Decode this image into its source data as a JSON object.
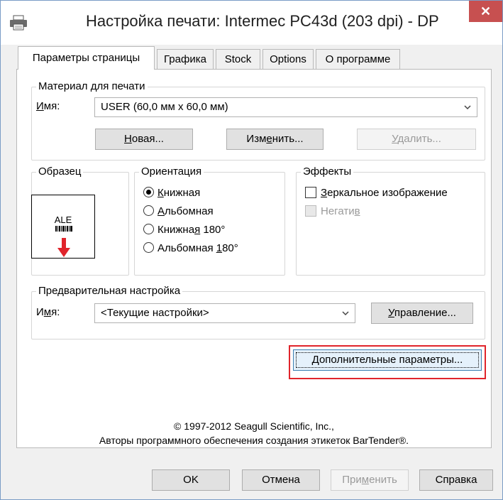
{
  "window": {
    "title": "Настройка печати: Intermec PC43d (203 dpi) - DP",
    "close_glyph": "✕"
  },
  "tabs": [
    {
      "label": "Параметры страницы",
      "active": true
    },
    {
      "label": "Графика",
      "active": false
    },
    {
      "label": "Stock",
      "active": false
    },
    {
      "label": "Options",
      "active": false
    },
    {
      "label": "О программе",
      "active": false
    }
  ],
  "media": {
    "group_label": "Материал для печати",
    "name_label_u": "И",
    "name_label_rest": "мя:",
    "selected": "USER (60,0 мм x 60,0 мм)",
    "new_u": "Н",
    "new_rest": "овая...",
    "edit_pre": "Изм",
    "edit_u": "е",
    "edit_rest": "нить...",
    "delete_u": "У",
    "delete_rest": "далить..."
  },
  "sample": {
    "group_label": "Образец",
    "preview_text": "ALE"
  },
  "orientation": {
    "group_label": "Ориентация",
    "options": [
      {
        "pre": "",
        "u": "К",
        "rest": "нижная",
        "selected": true
      },
      {
        "pre": "",
        "u": "А",
        "rest": "льбомная",
        "selected": false
      },
      {
        "pre": "Книжна",
        "u": "я",
        "rest": " 180°",
        "selected": false
      },
      {
        "pre": "Альбомная ",
        "u": "1",
        "rest": "80°",
        "selected": false
      }
    ]
  },
  "effects": {
    "group_label": "Эффекты",
    "mirror_u": "З",
    "mirror_rest": "еркальное изображение",
    "negative_pre": "Негати",
    "negative_u": "в"
  },
  "preset": {
    "group_label": "Предварительная настройка",
    "name_label_pre": "И",
    "name_label_u": "м",
    "name_label_rest": "я:",
    "selected": "<Текущие настройки>",
    "manage_u": "У",
    "manage_rest": "правление..."
  },
  "advanced": {
    "u": "Д",
    "rest": "ополнительные параметры..."
  },
  "footer": {
    "copyright": "© 1997-2012 Seagull Scientific, Inc.,",
    "authors": "Авторы программного обеспечения создания этикеток BarTender®."
  },
  "buttons": {
    "ok": "OK",
    "cancel": "Отмена",
    "apply_pre": "При",
    "apply_u": "м",
    "apply_rest": "енить",
    "help": "Справка"
  },
  "colors": {
    "highlight": "#e0242b",
    "close": "#c75050",
    "arrow": "#e0242b"
  }
}
